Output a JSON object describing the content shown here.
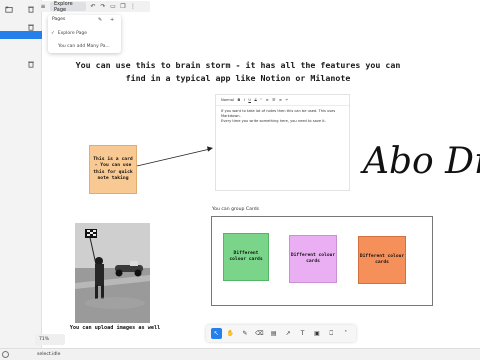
{
  "toolbar": {
    "page_label": "Explore Page"
  },
  "pages_menu": {
    "title": "Pages",
    "items": [
      {
        "label": "Explore Page",
        "checked": true
      },
      {
        "label": "You can add Many Pa..."
      }
    ]
  },
  "canvas": {
    "heading": "You can use this to brain storm - it has all the features you can find in a typical app like Notion or Milanote",
    "editor": {
      "toolbar": [
        "Normal",
        "B",
        "I",
        "U",
        "S",
        "“",
        "≡",
        "☰",
        "≡",
        "↵"
      ],
      "text_line1": "If you want to take lot of notes then this can be used. This uses Markdown.",
      "text_line2": "Every time you write something here, you need to save it."
    },
    "note_card": "This is a card - You can use this for quick note taking",
    "handwriting": "Abo Draw",
    "group_label": "You can group Cards",
    "group_cards": [
      {
        "text": "Different colour cards",
        "color": "#7ad58b"
      },
      {
        "text": "Different colour cards",
        "color": "#e9aff2"
      },
      {
        "text": "Different colour cards",
        "color": "#f5905b"
      }
    ],
    "image_caption": "You can upload images as well"
  },
  "tools": [
    {
      "name": "select-tool-icon",
      "glyph": "↖",
      "active": true
    },
    {
      "name": "hand-tool-icon",
      "glyph": "✋"
    },
    {
      "name": "pen-tool-icon",
      "glyph": "✎"
    },
    {
      "name": "eraser-tool-icon",
      "glyph": "⌫"
    },
    {
      "name": "note-tool-icon",
      "glyph": "▤"
    },
    {
      "name": "arrow-tool-icon",
      "glyph": "↗"
    },
    {
      "name": "text-tool-icon",
      "glyph": "T"
    },
    {
      "name": "image-tool-icon",
      "glyph": "▣"
    },
    {
      "name": "frame-tool-icon",
      "glyph": "⎕"
    },
    {
      "name": "more-tools-icon",
      "glyph": "˄"
    }
  ],
  "zoom": "71%",
  "status": "select.idle",
  "accent_color": "#2680eb"
}
